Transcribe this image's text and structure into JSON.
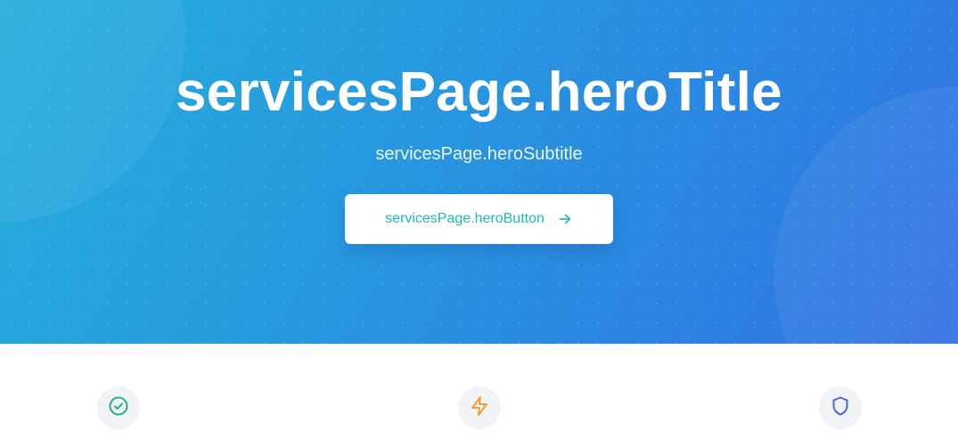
{
  "hero": {
    "title": "servicesPage.heroTitle",
    "subtitle": "servicesPage.heroSubtitle",
    "button_label": "servicesPage.heroButton",
    "button_icon": "arrow-right-icon"
  },
  "features": [
    {
      "icon": "check-circle-icon",
      "color": "#22b07d"
    },
    {
      "icon": "lightning-icon",
      "color": "#f0a030"
    },
    {
      "icon": "shield-icon",
      "color": "#4a63e0"
    }
  ],
  "colors": {
    "hero_gradient_start": "#26aedb",
    "hero_gradient_end": "#3371e3",
    "button_text": "#1fb9b0"
  }
}
